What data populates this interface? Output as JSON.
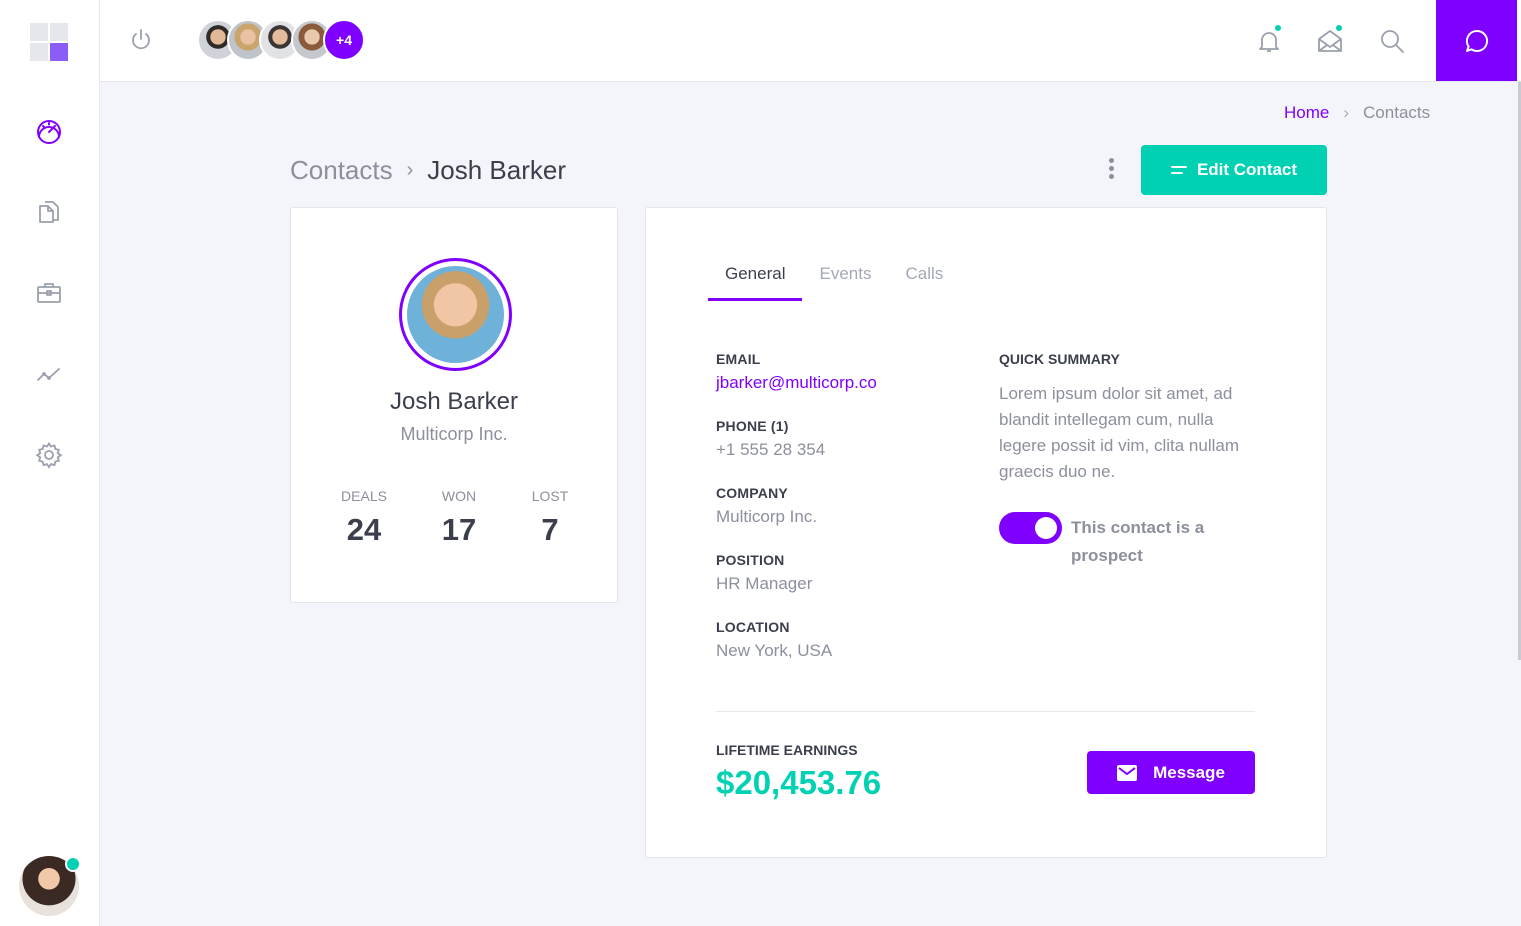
{
  "brand": {
    "accent": "#7f00ff",
    "success": "#00d1b2"
  },
  "sidebar": {
    "items": [
      {
        "icon": "dashboard-gauge-icon",
        "active": true
      },
      {
        "icon": "documents-icon",
        "active": false
      },
      {
        "icon": "briefcase-icon",
        "active": false
      },
      {
        "icon": "trend-chart-icon",
        "active": false
      },
      {
        "icon": "gear-icon",
        "active": false
      }
    ],
    "user_status": "online"
  },
  "topbar": {
    "team_more": "+4",
    "icons": [
      "power-icon",
      "bell-icon",
      "mail-icon",
      "search-icon",
      "chat-icon"
    ]
  },
  "breadcrumb": {
    "home": "Home",
    "current": "Contacts"
  },
  "page": {
    "parent": "Contacts",
    "current": "Josh Barker",
    "edit_label": "Edit Contact"
  },
  "profile": {
    "name": "Josh Barker",
    "company": "Multicorp Inc.",
    "stats": [
      {
        "label": "DEALS",
        "value": "24"
      },
      {
        "label": "WON",
        "value": "17"
      },
      {
        "label": "LOST",
        "value": "7"
      }
    ]
  },
  "details": {
    "tabs": [
      "General",
      "Events",
      "Calls"
    ],
    "active_tab": "General",
    "email": {
      "label": "EMAIL",
      "value": "jbarker@multicorp.co"
    },
    "phone": {
      "label": "PHONE (1)",
      "value": "+1 555 28 354"
    },
    "company": {
      "label": "COMPANY",
      "value": "Multicorp Inc."
    },
    "position": {
      "label": "POSITION",
      "value": "HR Manager"
    },
    "location": {
      "label": "LOCATION",
      "value": "New York, USA"
    },
    "summary": {
      "label": "QUICK SUMMARY",
      "text": "Lorem ipsum dolor sit amet, ad blandit intellegam cum, nulla legere possit id vim, clita nullam graecis duo ne."
    },
    "prospect": {
      "label": "This contact is a prospect",
      "on": true
    },
    "earnings": {
      "label": "LIFETIME EARNINGS",
      "value": "$20,453.76"
    },
    "message_label": "Message"
  }
}
